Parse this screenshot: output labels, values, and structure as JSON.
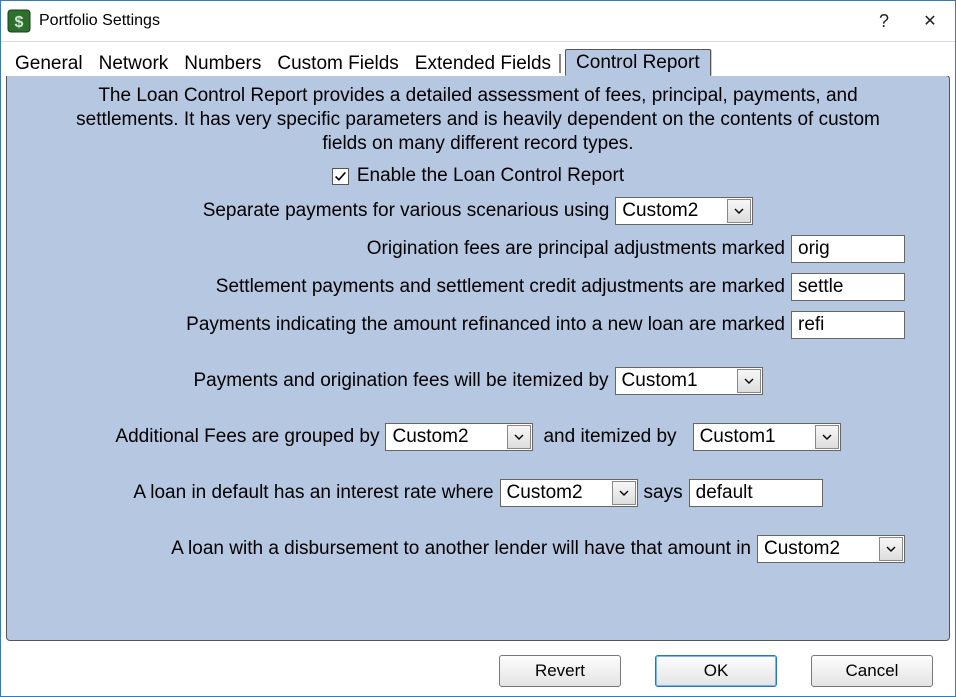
{
  "window": {
    "title": "Portfolio Settings",
    "help_glyph": "?",
    "close_glyph": "✕"
  },
  "tabs": [
    {
      "label": "General"
    },
    {
      "label": "Network"
    },
    {
      "label": "Numbers"
    },
    {
      "label": "Custom Fields"
    },
    {
      "label": "Extended Fields"
    },
    {
      "label": "Control Report",
      "selected": true
    }
  ],
  "panel": {
    "intro": "The Loan Control Report provides a detailed assessment of fees, principal, payments, and settlements.  It has very specific parameters and is heavily dependent on the contents of custom fields on many different record types.",
    "enable": {
      "checked": true,
      "label": "Enable the Loan Control Report"
    },
    "separate_payments": {
      "label": "Separate payments for various scenarious using",
      "value": "Custom2"
    },
    "origination_fees": {
      "label": "Origination fees are principal adjustments marked",
      "value": "orig"
    },
    "settlement_payments": {
      "label": "Settlement payments and settlement credit adjustments are marked",
      "value": "settle"
    },
    "refinanced_payments": {
      "label": "Payments indicating the amount refinanced into a new loan are marked",
      "value": "refi"
    },
    "itemized_by": {
      "label": "Payments and origination fees will be itemized by",
      "value": "Custom1"
    },
    "additional_fees": {
      "label_a": "Additional Fees are grouped by",
      "group_value": "Custom2",
      "label_b": "and itemized by",
      "item_value": "Custom1"
    },
    "default_loan": {
      "label_a": "A loan in default has an interest rate where",
      "field_value": "Custom2",
      "label_b": "says",
      "text_value": "default"
    },
    "disbursement": {
      "label": "A loan with a disbursement to another lender will have that amount in",
      "value": "Custom2"
    }
  },
  "buttons": {
    "revert": "Revert",
    "ok": "OK",
    "cancel": "Cancel"
  },
  "icons": {
    "dollar": "$"
  }
}
